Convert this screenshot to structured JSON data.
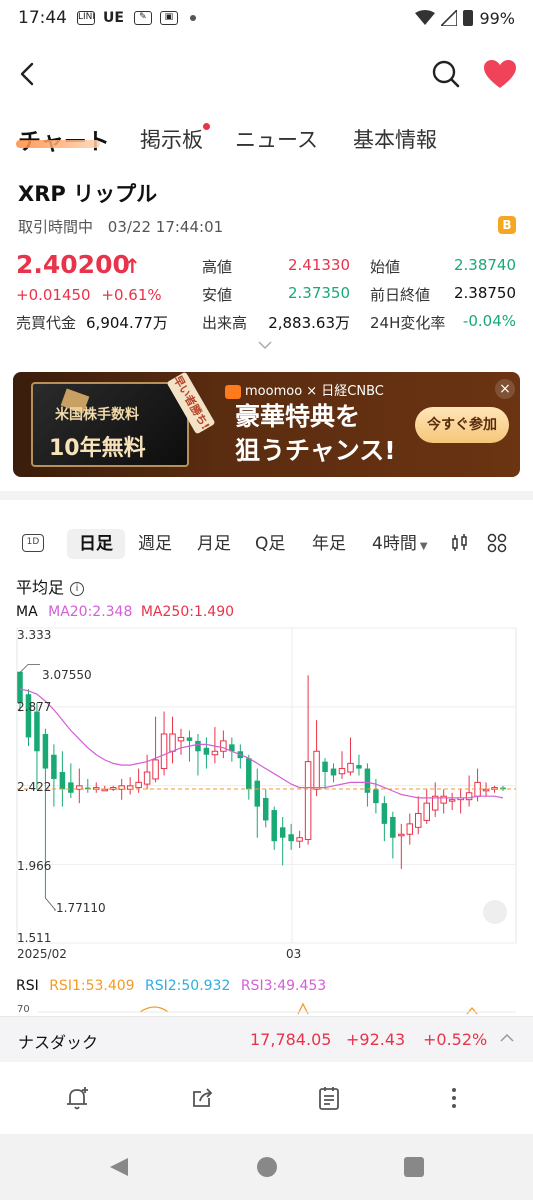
{
  "status_bar": {
    "time": "17:44",
    "icon1": "LINE",
    "icon2": "UE",
    "battery": "99%"
  },
  "tabs": [
    "チャート",
    "掲示板",
    "ニュース",
    "基本情報"
  ],
  "symbol": {
    "title": "XRP リップル",
    "status_label": "取引時間中",
    "timestamp": "03/22 17:44:01",
    "coin_badge": "B",
    "price": "2.40200",
    "arrow": "↑",
    "change": "+0.01450",
    "change_pct": "+0.61%",
    "turnover_label": "売買代金",
    "turnover_value": "6,904.77万"
  },
  "stats": {
    "high_label": "高値",
    "high": "2.41330",
    "open_label": "始値",
    "open": "2.38740",
    "low_label": "安値",
    "low": "2.37350",
    "prev_close_label": "前日終値",
    "prev_close": "2.38750",
    "volume_label": "出来高",
    "volume": "2,883.63万",
    "change24h_label": "24H変化率",
    "change24h": "-0.04%"
  },
  "banner": {
    "card_line1": "米国株手数料",
    "card_line2": "10年無料",
    "tag": "早い者勝ち!",
    "brand": "moomoo × 日経CNBC",
    "headline_line1": "豪華特典を",
    "headline_line2": "狙うチャンス!",
    "cta": "今すぐ参加",
    "close": "×"
  },
  "periods": {
    "d1": "1D",
    "items": [
      "日足",
      "週足",
      "月足",
      "Q足",
      "年足",
      "4時間"
    ],
    "active": "日足"
  },
  "chart_header": {
    "heikin": "平均足",
    "info": "i",
    "ma_label": "MA",
    "ma20": "MA20:2.348",
    "ma250": "MA250:1.490"
  },
  "chart_labels": {
    "y_ticks": [
      "3.333",
      "2.877",
      "2.422",
      "1.966",
      "1.511"
    ],
    "x_ticks": [
      "2025/02",
      "03"
    ],
    "max_annot": "3.07550",
    "min_annot": "1.77110"
  },
  "rsi": {
    "label": "RSI",
    "rsi1": "RSI1:53.409",
    "rsi2": "RSI2:50.932",
    "rsi3": "RSI3:49.453",
    "level70": "70"
  },
  "ticker": {
    "name": "ナスダック",
    "value": "17,784.05",
    "change": "+92.43",
    "change_pct": "+0.52%"
  },
  "colors": {
    "up": "#e8334a",
    "down": "#19a974",
    "ma20": "#d35fd6",
    "last_price_line": "#f59a23"
  },
  "chart_data": {
    "type": "candlestick",
    "style": "heikin-ashi",
    "x_labels": [
      "2025/02",
      "03"
    ],
    "ylim": [
      1.511,
      3.333
    ],
    "y_ticks": [
      3.333,
      2.877,
      2.422,
      1.966,
      1.511
    ],
    "annotations": [
      {
        "label": "3.07550",
        "value": 3.0755
      },
      {
        "label": "1.77110",
        "value": 1.7711
      }
    ],
    "candles": [
      {
        "o": 3.08,
        "c": 2.9,
        "h": 3.08,
        "l": 2.85
      },
      {
        "o": 2.95,
        "c": 2.7,
        "h": 2.98,
        "l": 2.65
      },
      {
        "o": 2.85,
        "c": 2.62,
        "h": 2.9,
        "l": 2.4
      },
      {
        "o": 2.72,
        "c": 2.52,
        "h": 2.75,
        "l": 1.77
      },
      {
        "o": 2.6,
        "c": 2.46,
        "h": 2.66,
        "l": 2.3
      },
      {
        "o": 2.5,
        "c": 2.4,
        "h": 2.62,
        "l": 2.3
      },
      {
        "o": 2.44,
        "c": 2.38,
        "h": 2.55,
        "l": 2.35
      },
      {
        "o": 2.4,
        "c": 2.42,
        "h": 2.52,
        "l": 2.32
      },
      {
        "o": 2.41,
        "c": 2.4,
        "h": 2.46,
        "l": 2.38
      },
      {
        "o": 2.4,
        "c": 2.41,
        "h": 2.44,
        "l": 2.38
      },
      {
        "o": 2.4,
        "c": 2.4,
        "h": 2.42,
        "l": 2.39
      },
      {
        "o": 2.4,
        "c": 2.41,
        "h": 2.42,
        "l": 2.39
      },
      {
        "o": 2.4,
        "c": 2.42,
        "h": 2.46,
        "l": 2.34
      },
      {
        "o": 2.4,
        "c": 2.42,
        "h": 2.47,
        "l": 2.37
      },
      {
        "o": 2.41,
        "c": 2.44,
        "h": 2.52,
        "l": 2.38
      },
      {
        "o": 2.43,
        "c": 2.5,
        "h": 2.6,
        "l": 2.4
      },
      {
        "o": 2.46,
        "c": 2.57,
        "h": 2.82,
        "l": 2.44
      },
      {
        "o": 2.52,
        "c": 2.72,
        "h": 2.85,
        "l": 2.48
      },
      {
        "o": 2.62,
        "c": 2.72,
        "h": 2.82,
        "l": 2.55
      },
      {
        "o": 2.68,
        "c": 2.7,
        "h": 2.75,
        "l": 2.6
      },
      {
        "o": 2.7,
        "c": 2.68,
        "h": 2.74,
        "l": 2.56
      },
      {
        "o": 2.68,
        "c": 2.62,
        "h": 2.72,
        "l": 2.48
      },
      {
        "o": 2.64,
        "c": 2.6,
        "h": 2.7,
        "l": 2.52
      },
      {
        "o": 2.6,
        "c": 2.62,
        "h": 2.76,
        "l": 2.55
      },
      {
        "o": 2.62,
        "c": 2.68,
        "h": 2.74,
        "l": 2.58
      },
      {
        "o": 2.66,
        "c": 2.62,
        "h": 2.7,
        "l": 2.56
      },
      {
        "o": 2.62,
        "c": 2.58,
        "h": 2.66,
        "l": 2.52
      },
      {
        "o": 2.58,
        "c": 2.4,
        "h": 2.6,
        "l": 2.34
      },
      {
        "o": 2.45,
        "c": 2.3,
        "h": 2.52,
        "l": 2.12
      },
      {
        "o": 2.35,
        "c": 2.22,
        "h": 2.4,
        "l": 2.18
      },
      {
        "o": 2.28,
        "c": 2.1,
        "h": 2.3,
        "l": 2.05
      },
      {
        "o": 2.18,
        "c": 2.12,
        "h": 2.24,
        "l": 1.96
      },
      {
        "o": 2.14,
        "c": 2.1,
        "h": 2.2,
        "l": 2.05
      },
      {
        "o": 2.1,
        "c": 2.12,
        "h": 2.16,
        "l": 2.06
      },
      {
        "o": 2.11,
        "c": 2.56,
        "h": 3.06,
        "l": 2.08
      },
      {
        "o": 2.4,
        "c": 2.62,
        "h": 2.8,
        "l": 2.36
      },
      {
        "o": 2.56,
        "c": 2.5,
        "h": 2.58,
        "l": 2.4
      },
      {
        "o": 2.52,
        "c": 2.48,
        "h": 2.55,
        "l": 2.44
      },
      {
        "o": 2.49,
        "c": 2.52,
        "h": 2.62,
        "l": 2.46
      },
      {
        "o": 2.5,
        "c": 2.55,
        "h": 2.7,
        "l": 2.48
      },
      {
        "o": 2.54,
        "c": 2.52,
        "h": 2.6,
        "l": 2.48
      },
      {
        "o": 2.52,
        "c": 2.38,
        "h": 2.55,
        "l": 2.3
      },
      {
        "o": 2.4,
        "c": 2.32,
        "h": 2.46,
        "l": 2.26
      },
      {
        "o": 2.32,
        "c": 2.2,
        "h": 2.36,
        "l": 2.1
      },
      {
        "o": 2.24,
        "c": 2.12,
        "h": 2.27,
        "l": 2.0
      },
      {
        "o": 2.14,
        "c": 2.14,
        "h": 2.2,
        "l": 1.94
      },
      {
        "o": 2.14,
        "c": 2.2,
        "h": 2.26,
        "l": 2.08
      },
      {
        "o": 2.18,
        "c": 2.26,
        "h": 2.36,
        "l": 2.14
      },
      {
        "o": 2.22,
        "c": 2.32,
        "h": 2.4,
        "l": 2.2
      },
      {
        "o": 2.28,
        "c": 2.36,
        "h": 2.44,
        "l": 2.24
      },
      {
        "o": 2.32,
        "c": 2.36,
        "h": 2.4,
        "l": 2.26
      },
      {
        "o": 2.34,
        "c": 2.34,
        "h": 2.38,
        "l": 2.28
      },
      {
        "o": 2.34,
        "c": 2.35,
        "h": 2.4,
        "l": 2.26
      },
      {
        "o": 2.34,
        "c": 2.38,
        "h": 2.48,
        "l": 2.3
      },
      {
        "o": 2.36,
        "c": 2.44,
        "h": 2.52,
        "l": 2.33
      },
      {
        "o": 2.4,
        "c": 2.4,
        "h": 2.44,
        "l": 2.36
      },
      {
        "o": 2.4,
        "c": 2.41,
        "h": 2.42,
        "l": 2.38
      },
      {
        "o": 2.41,
        "c": 2.4,
        "h": 2.42,
        "l": 2.39
      }
    ],
    "ma20": [
      2.98,
      2.97,
      2.95,
      2.91,
      2.86,
      2.8,
      2.74,
      2.69,
      2.64,
      2.6,
      2.57,
      2.55,
      2.54,
      2.54,
      2.55,
      2.56,
      2.58,
      2.6,
      2.62,
      2.64,
      2.65,
      2.66,
      2.66,
      2.65,
      2.64,
      2.62,
      2.6,
      2.58,
      2.55,
      2.52,
      2.49,
      2.46,
      2.43,
      2.41,
      2.41,
      2.41,
      2.41,
      2.42,
      2.43,
      2.44,
      2.44,
      2.44,
      2.43,
      2.41,
      2.39,
      2.37,
      2.36,
      2.35,
      2.35,
      2.35,
      2.35,
      2.35,
      2.35,
      2.35,
      2.36,
      2.36,
      2.36,
      2.35
    ],
    "last_price": 2.402
  }
}
